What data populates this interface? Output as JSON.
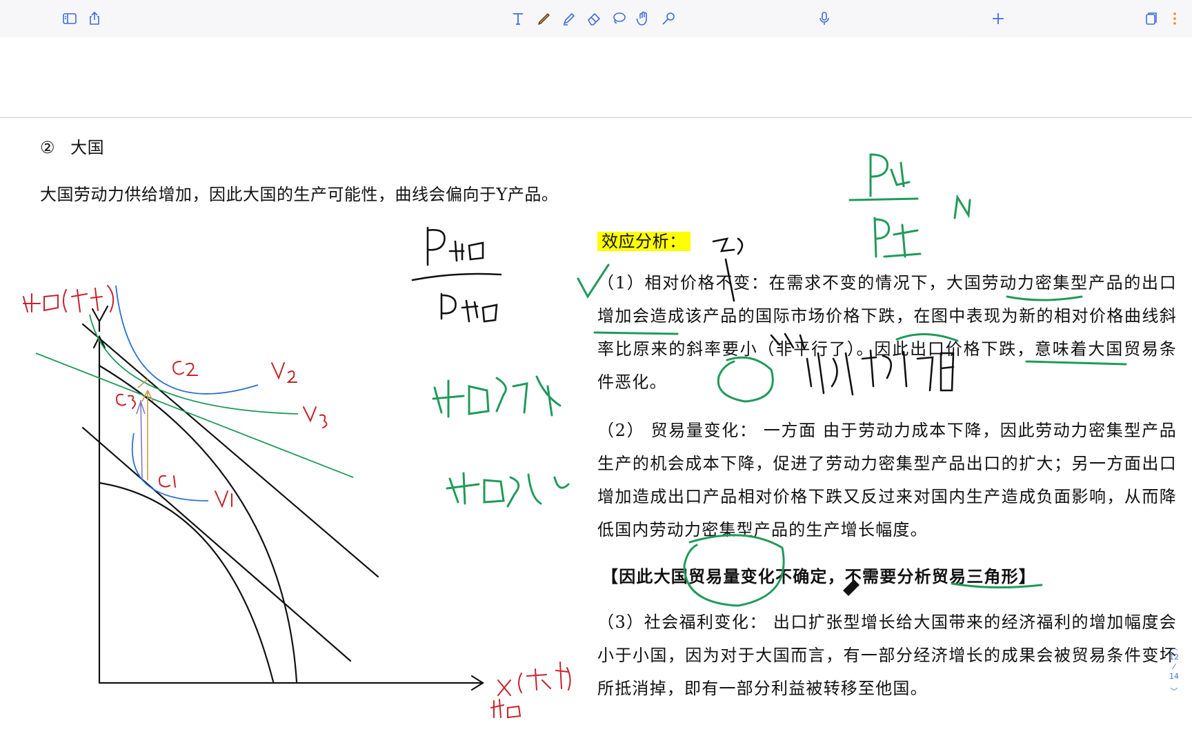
{
  "toolbar": {
    "left_icons": [
      "sidebar-icon",
      "share-icon"
    ],
    "tools": [
      "text-tool-icon",
      "pen-tool-icon",
      "highlighter-tool-icon",
      "eraser-tool-icon",
      "lasso-tool-icon",
      "hand-tool-icon",
      "laser-tool-icon"
    ],
    "mic_icon": "microphone-icon",
    "right_icons": [
      "add-page-icon",
      "pages-icon",
      "more-icon"
    ]
  },
  "pen_tray": {
    "colors": [
      "#e8862e",
      "#111111",
      "#ffffff",
      "#e8a0a8",
      "#e88a2c",
      "#cccccc",
      "#b8242c",
      "#2a9d5c"
    ]
  },
  "heading": {
    "number": "②",
    "title": "大国"
  },
  "intro": "大国劳动力供给增加，因此大国的生产可能性，曲线会偏向于Y产品。",
  "effect_title": "效应分析：",
  "p1": "（1）相对价格不变：在需求不变的情况下，大国劳动力密集型产品的出口增加会造成该产品的国际市场价格下跌，在图中表现为新的相对价格曲线斜率比原来的斜率要小（非平行了）。因此出口价格下跌，意味着大国贸易条件恶化。",
  "p2": "（2） 贸易量变化： 一方面 由于劳动力成本下降，因此劳动力密集型产品生产的机会成本下降，促进了劳动力密集型产品出口的扩大；另一方面出口增加造成出口产品相对价格下跌又反过来对国内生产造成负面影响，从而降低国内劳动力密集型产品的生产增长幅度。",
  "bold_note": "【因此大国贸易量变化不确定，不需要分析贸易三角形】",
  "p3": "（3）社会福利变化： 出口扩张型增长给大国带来的经济福利的增加幅度会小于小国，因为对于大国而言，有一部分经济增长的成果会被贸易条件变坏所抵消掉，即有一部分利益被转移至他国。",
  "page_indicator": {
    "current": "12",
    "total": "14"
  },
  "colors": {
    "ink_black": "#111111",
    "ink_red": "#c8202a",
    "ink_green": "#1f9a5a",
    "ink_blue": "#2a6fd0",
    "ink_orange": "#d9954a",
    "highlight": "#ffff00",
    "accent": "#3b6fd8"
  }
}
